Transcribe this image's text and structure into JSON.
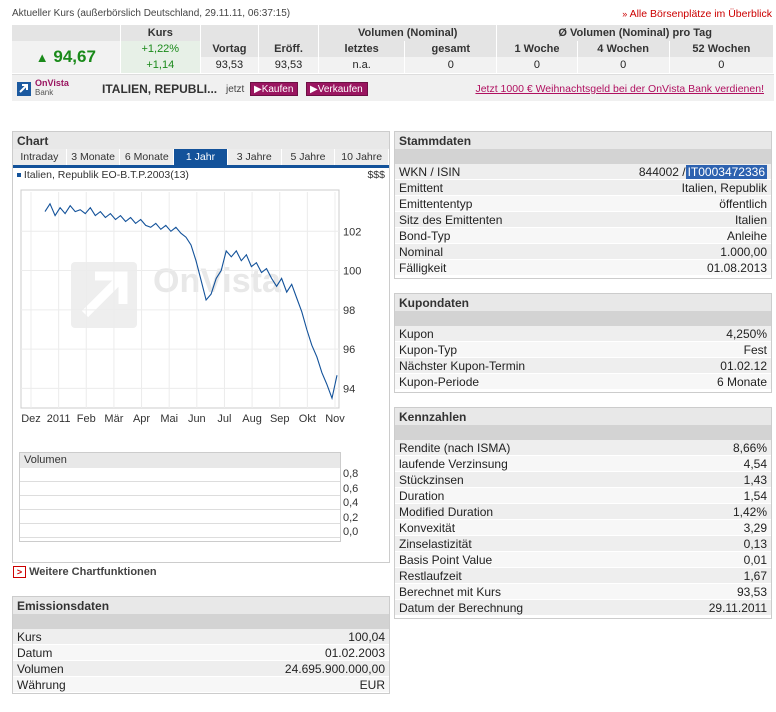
{
  "header": {
    "label": "Aktueller Kurs (außerbörslich Deutschland, 29.11.11, 06:37:15)",
    "link": "Alle Börsenplätze im Überblick"
  },
  "quote": {
    "col_kurs": "Kurs",
    "col_volumen": "Volumen (Nominal)",
    "col_avg_volumen": "Ø Volumen (Nominal) pro Tag",
    "sub_vortag": "Vortag",
    "sub_eroeff": "Eröff.",
    "sub_letztes": "letztes",
    "sub_gesamt": "gesamt",
    "sub_1w": "1 Woche",
    "sub_4w": "4 Wochen",
    "sub_52w": "52 Wochen",
    "price": "94,67",
    "change_pct": "+1,22%",
    "change_abs": "+1,14",
    "vortag": "93,53",
    "eroeff": "93,53",
    "letztes": "n.a.",
    "gesamt": "0",
    "avg_1w": "0",
    "avg_4w": "0",
    "avg_52w": "0"
  },
  "bank": {
    "logo_line1": "OnVista",
    "logo_line2": "Bank",
    "name": "ITALIEN, REPUBLI...",
    "jetzt": "jetzt",
    "kaufen": "Kaufen",
    "verkaufen": "Verkaufen",
    "promo": "Jetzt 1000 € Weihnachtsgeld bei der OnVista Bank verdienen!"
  },
  "chart_panel": {
    "title": "Chart",
    "tabs": [
      "Intraday",
      "3 Monate",
      "6 Monate",
      "1 Jahr",
      "3 Jahre",
      "5 Jahre",
      "10 Jahre"
    ],
    "active_tab": 3,
    "series_label": "Italien, Republik EO-B.T.P.2003(13)",
    "currency_icon": "$$$",
    "watermark": "OnVista",
    "volume_title": "Volumen",
    "volume_ticks": [
      "0,8",
      "0,6",
      "0,4",
      "0,2",
      "0,0"
    ],
    "more_link": "Weitere Chartfunktionen"
  },
  "chart_data": {
    "type": "line",
    "title": "",
    "xlabel": "",
    "ylabel": "",
    "x_ticks": [
      "Dez",
      "2011",
      "Feb",
      "Mär",
      "Apr",
      "Mai",
      "Jun",
      "Jul",
      "Aug",
      "Sep",
      "Okt",
      "Nov"
    ],
    "y_ticks": [
      94,
      96,
      98,
      100,
      102
    ],
    "ylim": [
      93,
      104
    ],
    "series": [
      {
        "name": "Italien, Republik EO-B.T.P.2003(13)",
        "values": [
          103.0,
          103.4,
          102.8,
          103.2,
          102.9,
          103.3,
          103.0,
          103.1,
          102.9,
          103.2,
          102.8,
          103.0,
          102.7,
          102.9,
          102.6,
          102.8,
          102.5,
          102.7,
          102.4,
          102.6,
          102.3,
          102.2,
          102.4,
          102.1,
          102.3,
          102.0,
          102.2,
          101.9,
          101.7,
          101.3,
          100.5,
          99.5,
          98.5,
          98.8,
          99.6,
          100.0,
          101.0,
          100.7,
          101.0,
          100.5,
          100.8,
          100.2,
          100.4,
          99.9,
          100.1,
          99.6,
          99.2,
          99.6,
          98.9,
          99.3,
          98.6,
          97.9,
          97.0,
          96.2,
          95.6,
          94.8,
          94.2,
          93.5,
          94.67
        ]
      }
    ],
    "grid": true
  },
  "emission": {
    "title": "Emissionsdaten",
    "rows": [
      {
        "label": "Kurs",
        "value": "100,04"
      },
      {
        "label": "Datum",
        "value": "01.02.2003"
      },
      {
        "label": "Volumen",
        "value": "24.695.900.000,00"
      },
      {
        "label": "Währung",
        "value": "EUR"
      }
    ]
  },
  "stammdaten": {
    "title": "Stammdaten",
    "wkn_label": "WKN / ISIN",
    "wkn": "844002 /",
    "isin": "IT0003472336",
    "rows": [
      {
        "label": "Emittent",
        "value": "Italien, Republik"
      },
      {
        "label": "Emittententyp",
        "value": "öffentlich"
      },
      {
        "label": "Sitz des Emittenten",
        "value": "Italien"
      },
      {
        "label": "Bond-Typ",
        "value": "Anleihe"
      },
      {
        "label": "Nominal",
        "value": "1.000,00"
      },
      {
        "label": "Fälligkeit",
        "value": "01.08.2013"
      }
    ]
  },
  "kupondaten": {
    "title": "Kupondaten",
    "rows": [
      {
        "label": "Kupon",
        "value": "4,250%"
      },
      {
        "label": "Kupon-Typ",
        "value": "Fest"
      },
      {
        "label": "Nächster Kupon-Termin",
        "value": "01.02.12"
      },
      {
        "label": "Kupon-Periode",
        "value": "6 Monate"
      }
    ]
  },
  "kennzahlen": {
    "title": "Kennzahlen",
    "rows": [
      {
        "label": "Rendite (nach ISMA)",
        "value": "8,66%"
      },
      {
        "label": "laufende Verzinsung",
        "value": "4,54"
      },
      {
        "label": "Stückzinsen",
        "value": "1,43"
      },
      {
        "label": "Duration",
        "value": "1,54"
      },
      {
        "label": "Modified Duration",
        "value": "1,42%"
      },
      {
        "label": "Konvexität",
        "value": "3,29"
      },
      {
        "label": "Zinselastizität",
        "value": "0,13"
      },
      {
        "label": "Basis Point Value",
        "value": "0,01"
      },
      {
        "label": "Restlaufzeit",
        "value": "1,67"
      },
      {
        "label": "Berechnet mit Kurs",
        "value": "93,53"
      },
      {
        "label": "Datum der Berechnung",
        "value": "29.11.2011"
      }
    ]
  },
  "colors": {
    "accent": "#13529a",
    "positive": "#1a8a1a",
    "link_red": "#cc0000",
    "bank_button": "#9a1560"
  }
}
